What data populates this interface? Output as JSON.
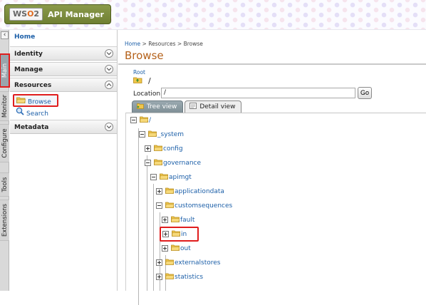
{
  "header": {
    "logo_prefix": "WS",
    "logo_o": "O",
    "logo_two": "2",
    "product_name": "API Manager"
  },
  "rail": {
    "toggle_glyph": "‹",
    "tabs": [
      {
        "label": "Main"
      },
      {
        "label": "Monitor"
      },
      {
        "label": "Configure"
      },
      {
        "label": "Tools"
      },
      {
        "label": "Extensions"
      }
    ]
  },
  "menu": {
    "home_label": "Home",
    "sections": [
      {
        "label": "Identity"
      },
      {
        "label": "Manage"
      },
      {
        "label": "Resources"
      },
      {
        "label": "Metadata"
      }
    ],
    "resources_items": [
      {
        "label": "Browse",
        "icon": "folder-icon"
      },
      {
        "label": "Search",
        "icon": "search-icon"
      }
    ]
  },
  "content": {
    "breadcrumb_home": "Home",
    "breadcrumb_rest": " > Resources > Browse",
    "page_title": "Browse",
    "root_label": "Root",
    "root_path": "/",
    "location_label": "Location:",
    "location_value": "/",
    "go_label": "Go",
    "tabs": [
      {
        "label": "Tree view",
        "active": true
      },
      {
        "label": "Detail view",
        "active": false
      }
    ],
    "tree": [
      {
        "label": "/",
        "expanded": true
      },
      {
        "label": "_system",
        "expanded": true
      },
      {
        "label": "config",
        "expanded": false
      },
      {
        "label": "governance",
        "expanded": true
      },
      {
        "label": "apimgt",
        "expanded": true
      },
      {
        "label": "applicationdata",
        "expanded": false
      },
      {
        "label": "customsequences",
        "expanded": true
      },
      {
        "label": "fault",
        "expanded": false
      },
      {
        "label": "in",
        "expanded": false,
        "highlighted": true
      },
      {
        "label": "out",
        "expanded": false
      },
      {
        "label": "externalstores",
        "expanded": false
      },
      {
        "label": "statistics",
        "expanded": false
      }
    ]
  },
  "colors": {
    "link": "#1c5fa8",
    "title": "#b5621b",
    "highlight": "#e01d1d",
    "folder": "#f0c64a"
  }
}
